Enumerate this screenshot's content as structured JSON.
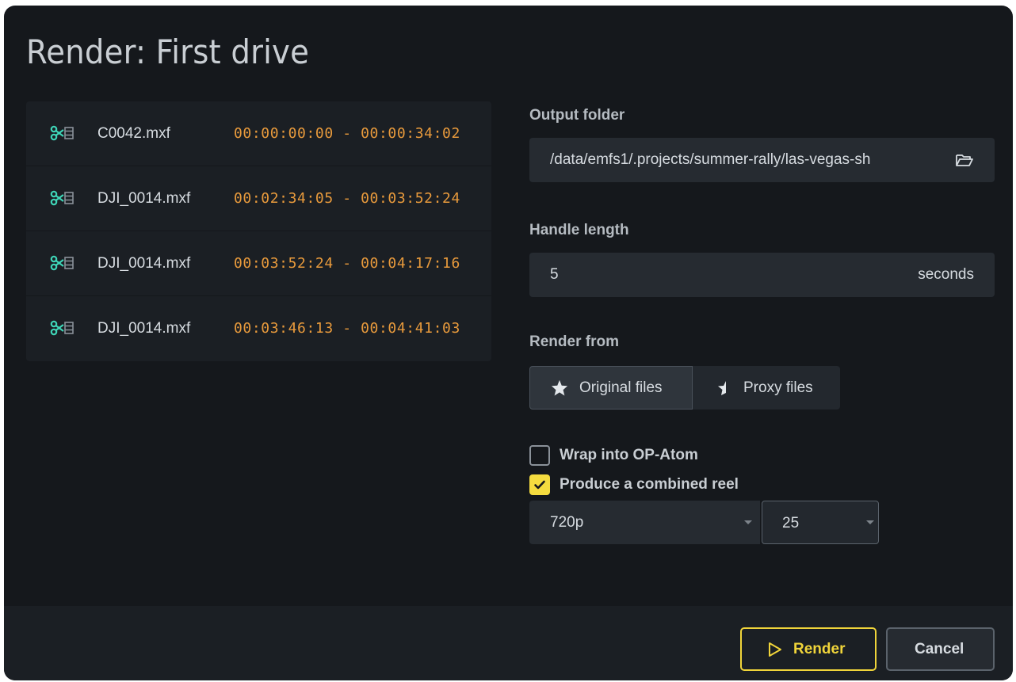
{
  "dialog": {
    "title": "Render: First drive"
  },
  "clips": [
    {
      "icon": "scissors-film-icon",
      "name": "C0042.mxf",
      "range": "00:00:00:00 - 00:00:34:02"
    },
    {
      "icon": "scissors-film-icon",
      "name": "DJI_0014.mxf",
      "range": "00:02:34:05 - 00:03:52:24"
    },
    {
      "icon": "scissors-film-icon",
      "name": "DJI_0014.mxf",
      "range": "00:03:52:24 - 00:04:17:16"
    },
    {
      "icon": "scissors-film-icon",
      "name": "DJI_0014.mxf",
      "range": "00:03:46:13 - 00:04:41:03"
    }
  ],
  "output_folder": {
    "label": "Output folder",
    "value": "/data/emfs1/.projects/summer-rally/las-vegas-sh",
    "icon": "folder-open-icon"
  },
  "handle_length": {
    "label": "Handle length",
    "value": "5",
    "unit": "seconds"
  },
  "render_from": {
    "label": "Render from",
    "options": [
      {
        "label": "Original files",
        "icon": "star-icon",
        "selected": true
      },
      {
        "label": "Proxy files",
        "icon": "half-star-icon",
        "selected": false
      }
    ]
  },
  "options": {
    "wrap_op_atom": {
      "label": "Wrap into OP-Atom",
      "checked": false
    },
    "combined_reel": {
      "label": "Produce a combined reel",
      "checked": true
    }
  },
  "reel": {
    "resolution": "720p",
    "fps": "25"
  },
  "footer": {
    "render_label": "Render",
    "cancel_label": "Cancel"
  },
  "colors": {
    "background": "#15181c",
    "timecode": "#e89a3c",
    "accent_yellow": "#f0d43a",
    "clip_icon": "#3fd6b8"
  }
}
